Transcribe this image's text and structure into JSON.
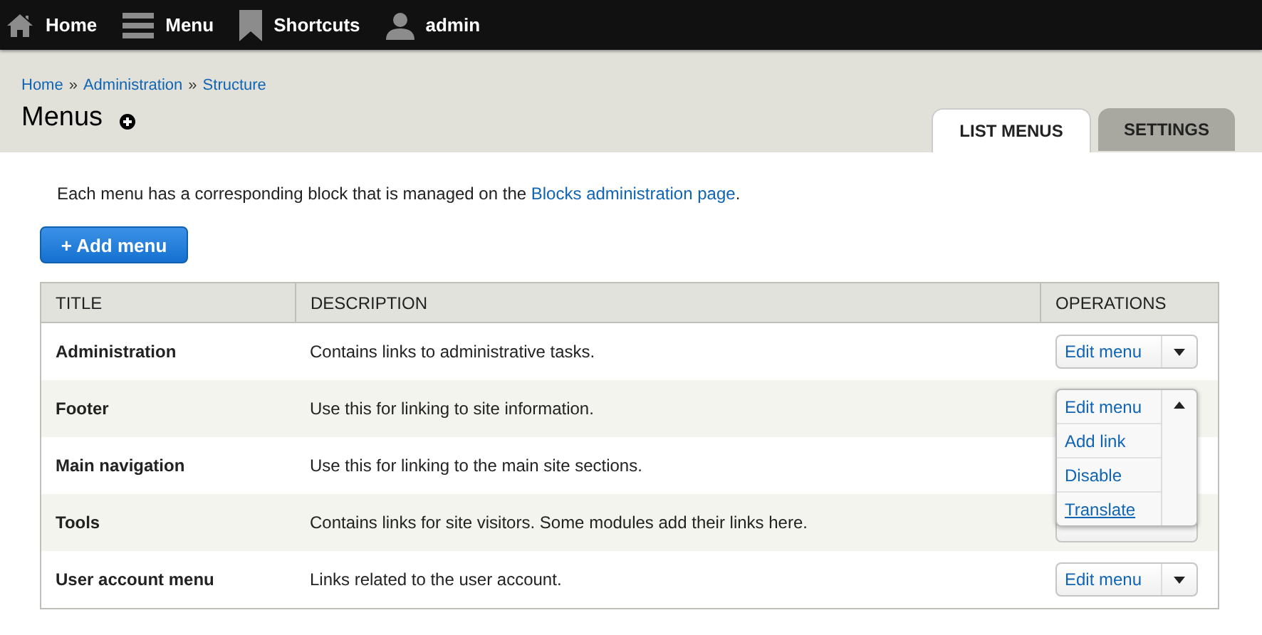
{
  "toolbar": [
    {
      "kind": "home",
      "label": "Home"
    },
    {
      "kind": "menu",
      "label": "Menu"
    },
    {
      "kind": "bookmark",
      "label": "Shortcuts"
    },
    {
      "kind": "user",
      "label": "admin"
    }
  ],
  "breadcrumb": [
    "Home",
    "Administration",
    "Structure"
  ],
  "breadcrumb_separator": "»",
  "page_title": "Menus",
  "tabs": [
    {
      "label": "LIST MENUS",
      "selected": true
    },
    {
      "label": "SETTINGS",
      "selected": false
    }
  ],
  "intro": {
    "text": "Each menu has a corresponding block that is managed on the ",
    "link": "Blocks administration page",
    "end": "."
  },
  "add_button": "+ Add menu",
  "table": {
    "columns": [
      "TITLE",
      "DESCRIPTION",
      "OPERATIONS"
    ],
    "rows": [
      {
        "title": "Administration",
        "description": "Contains links to administrative tasks.",
        "operation": {
          "label": "Edit menu",
          "expanded": false,
          "covered": false
        }
      },
      {
        "title": "Footer",
        "description": "Use this for linking to site information.",
        "operation": {
          "label": "Edit menu",
          "expanded": true,
          "covered": false,
          "links": [
            {
              "label": "Add link",
              "hovered": false
            },
            {
              "label": "Disable",
              "hovered": false
            },
            {
              "label": "Translate",
              "hovered": true
            }
          ]
        }
      },
      {
        "title": "Main navigation",
        "description": "Use this for linking to the main site sections."
      },
      {
        "title": "Tools",
        "description": "Contains links for site visitors. Some modules add their links here.",
        "operation": {
          "covered": true
        }
      },
      {
        "title": "User account menu",
        "description": "Links related to the user account.",
        "operation": {
          "label": "Edit menu",
          "expanded": false,
          "covered": false
        }
      }
    ]
  }
}
